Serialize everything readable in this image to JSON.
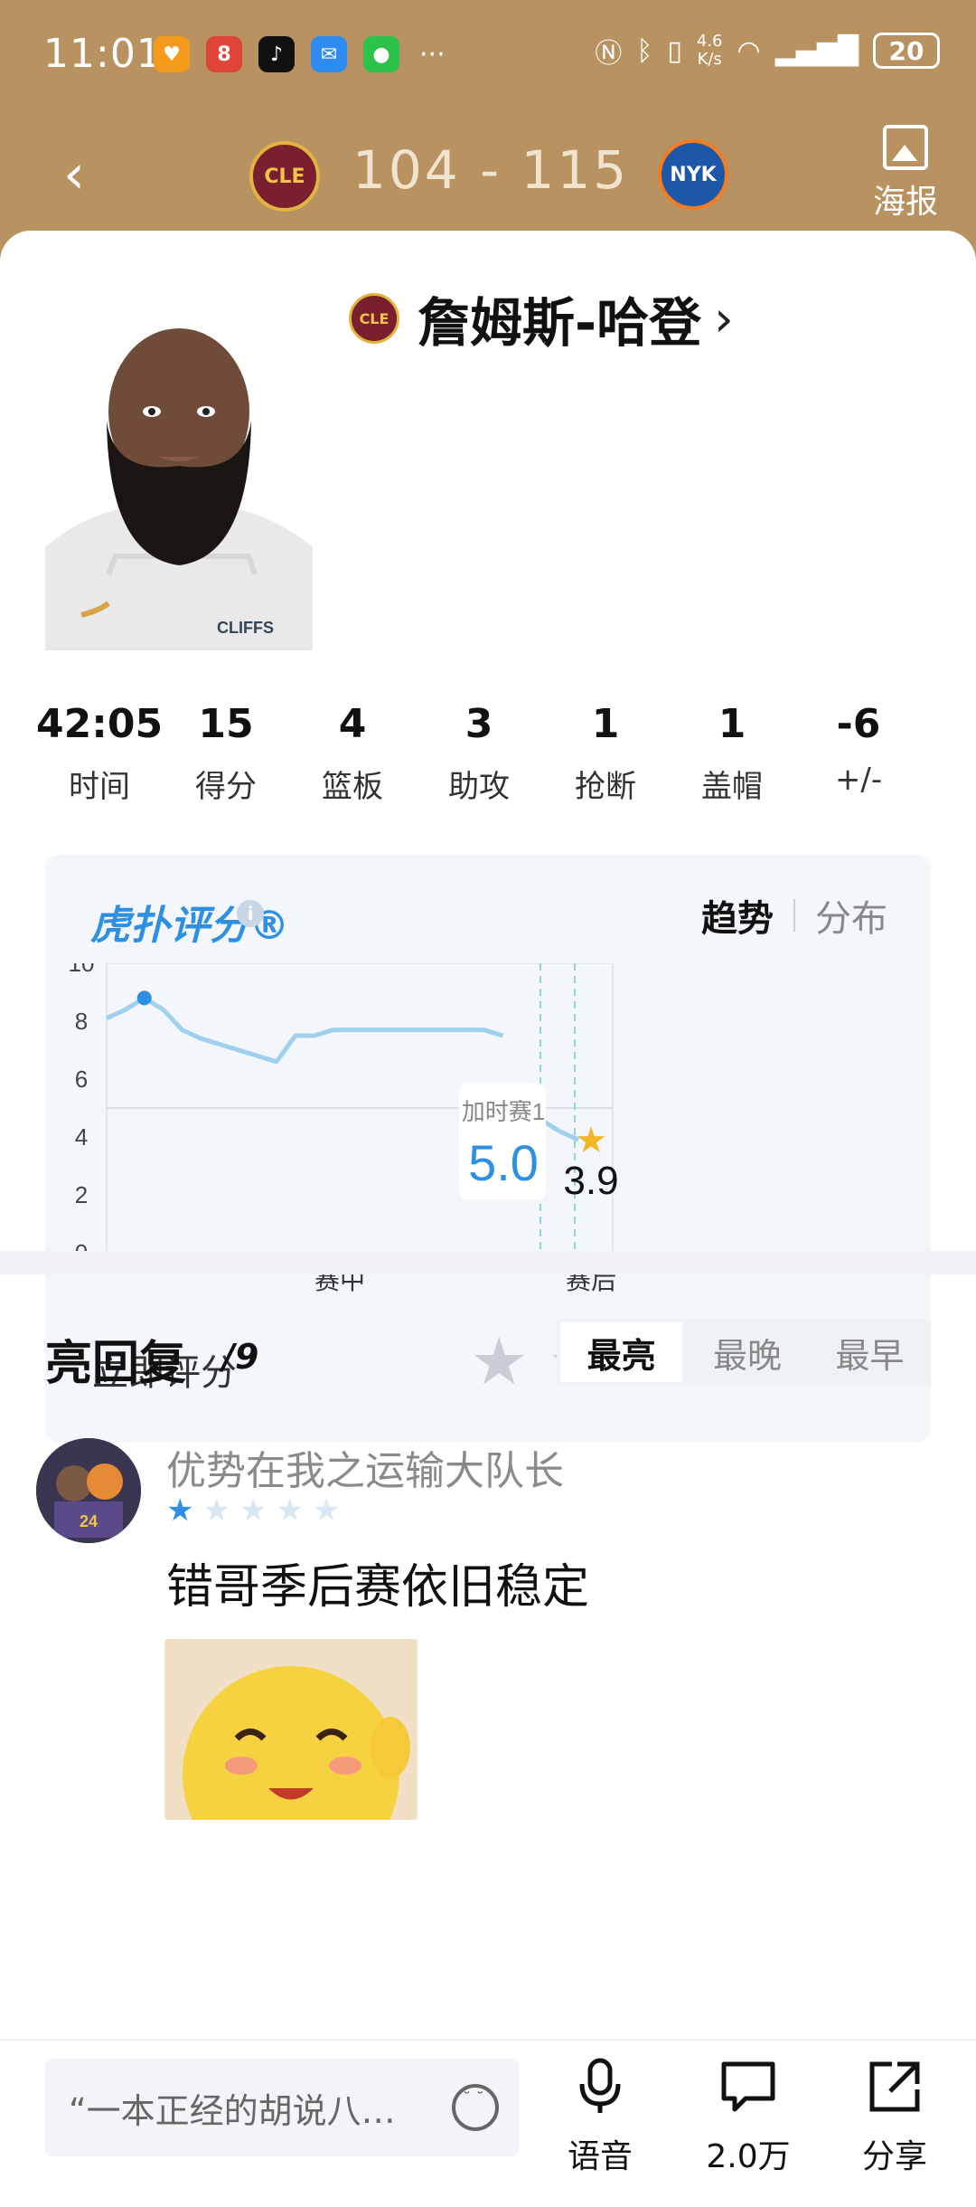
{
  "status_bar": {
    "time": "11:01",
    "speed_top": "4.6",
    "speed_bottom": "K/s",
    "battery": "20"
  },
  "header": {
    "home_team": "CLE",
    "away_team": "NYK",
    "score": "104 - 115",
    "poster_label": "海报"
  },
  "player": {
    "name": "詹姆斯-哈登",
    "team_logo": "CLE"
  },
  "stats": [
    {
      "value": "42:05",
      "label": "时间"
    },
    {
      "value": "15",
      "label": "得分"
    },
    {
      "value": "4",
      "label": "篮板"
    },
    {
      "value": "3",
      "label": "助攻"
    },
    {
      "value": "1",
      "label": "抢断"
    },
    {
      "value": "1",
      "label": "盖帽"
    },
    {
      "value": "-6",
      "label": "+/-"
    }
  ],
  "rating": {
    "brand": "虎扑评分®",
    "tab_trend": "趋势",
    "tab_distribution": "分布",
    "rate_now": "立即评分",
    "tooltip_label": "加时赛1",
    "tooltip_value": "5.0",
    "final_score": "3.9",
    "x_label_mid": "赛中",
    "x_label_end": "赛后"
  },
  "chart_data": {
    "type": "line",
    "title": "",
    "ylim": [
      0,
      10
    ],
    "yticks": [
      "10",
      "8",
      "6",
      "4",
      "2",
      "0"
    ],
    "series": [
      {
        "values": [
          8.1,
          8.4,
          8.8,
          8.4,
          7.7,
          7.4,
          7.2,
          7.0,
          6.8,
          6.6,
          7.5,
          7.5,
          7.7,
          7.7,
          7.7,
          7.7,
          7.7,
          7.7,
          7.7,
          7.7,
          7.7,
          7.5,
          5.0,
          4.6,
          4.2,
          3.9
        ]
      }
    ],
    "highlight_points": [
      {
        "label": "加时赛1",
        "value": 5.0
      },
      {
        "label": "赛后",
        "value": 3.9
      }
    ]
  },
  "comments": {
    "title": "亮回复",
    "count": "/9",
    "sort": [
      "最亮",
      "最晚",
      "最早"
    ],
    "items": [
      {
        "user": "优势在我之运输大队长",
        "stars": 1,
        "text": "错哥季后赛依旧稳定"
      }
    ]
  },
  "bottom_bar": {
    "input_placeholder": "“一本正经的胡说八…",
    "voice": "语音",
    "comment_count": "2.0万",
    "share": "分享"
  },
  "colors": {
    "header": "#b89260",
    "accent": "#2f8fe0",
    "star_gold": "#f5b623"
  },
  "icons": [
    "back-icon",
    "poster-icon",
    "chevron-right-icon",
    "info-icon",
    "star-icon",
    "mic-icon",
    "comment-icon",
    "share-icon",
    "emoji-icon"
  ]
}
